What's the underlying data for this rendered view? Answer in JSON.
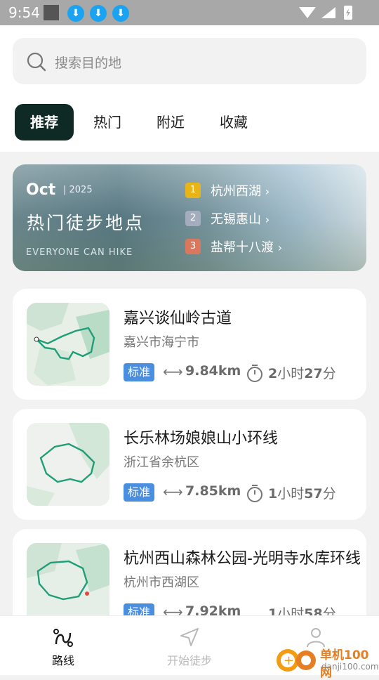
{
  "status_bar": {
    "time": "9:54"
  },
  "search": {
    "placeholder": "搜索目的地"
  },
  "tabs": [
    {
      "label": "推荐",
      "active": true
    },
    {
      "label": "热门",
      "active": false
    },
    {
      "label": "附近",
      "active": false
    },
    {
      "label": "收藏",
      "active": false
    }
  ],
  "banner": {
    "month": "Oct",
    "year": "| 2025",
    "title": "热门徒步地点",
    "subtitle": "EVERYONE CAN HIKE",
    "ranks": [
      {
        "num": "1",
        "name": "杭州西湖",
        "color": "#e9b418"
      },
      {
        "num": "2",
        "name": "无锡惠山",
        "color": "#a3adbd"
      },
      {
        "num": "3",
        "name": "盐帮十八渡",
        "color": "#d9785f"
      }
    ]
  },
  "routes": [
    {
      "title": "嘉兴谈仙岭古道",
      "location": "嘉兴市海宁市",
      "level": "标准",
      "distance": "9.84km",
      "time_h": "2",
      "time_h_unit": "小时",
      "time_m": "27",
      "time_m_unit": "分"
    },
    {
      "title": "长乐林场娘娘山小环线",
      "location": "浙江省余杭区",
      "level": "标准",
      "distance": "7.85km",
      "time_h": "1",
      "time_h_unit": "小时",
      "time_m": "57",
      "time_m_unit": "分"
    },
    {
      "title": "杭州西山森林公园-光明寺水库环线",
      "location": "杭州市西湖区",
      "level": "标准",
      "distance": "7.92km",
      "time_h": "1",
      "time_h_unit": "小时",
      "time_m": "58",
      "time_m_unit": "分"
    }
  ],
  "bottom_nav": [
    {
      "label": "路线",
      "icon": "route-icon",
      "active": true
    },
    {
      "label": "开始徒步",
      "icon": "navigate-icon",
      "active": false
    },
    {
      "label": "",
      "icon": "user-icon",
      "active": false
    }
  ],
  "watermark": {
    "cn": "单机100网",
    "url": "danji100.com"
  },
  "colors": {
    "accent": "#0f2a24",
    "badge": "#4a8ee0",
    "route_line": "#1f9e78"
  }
}
